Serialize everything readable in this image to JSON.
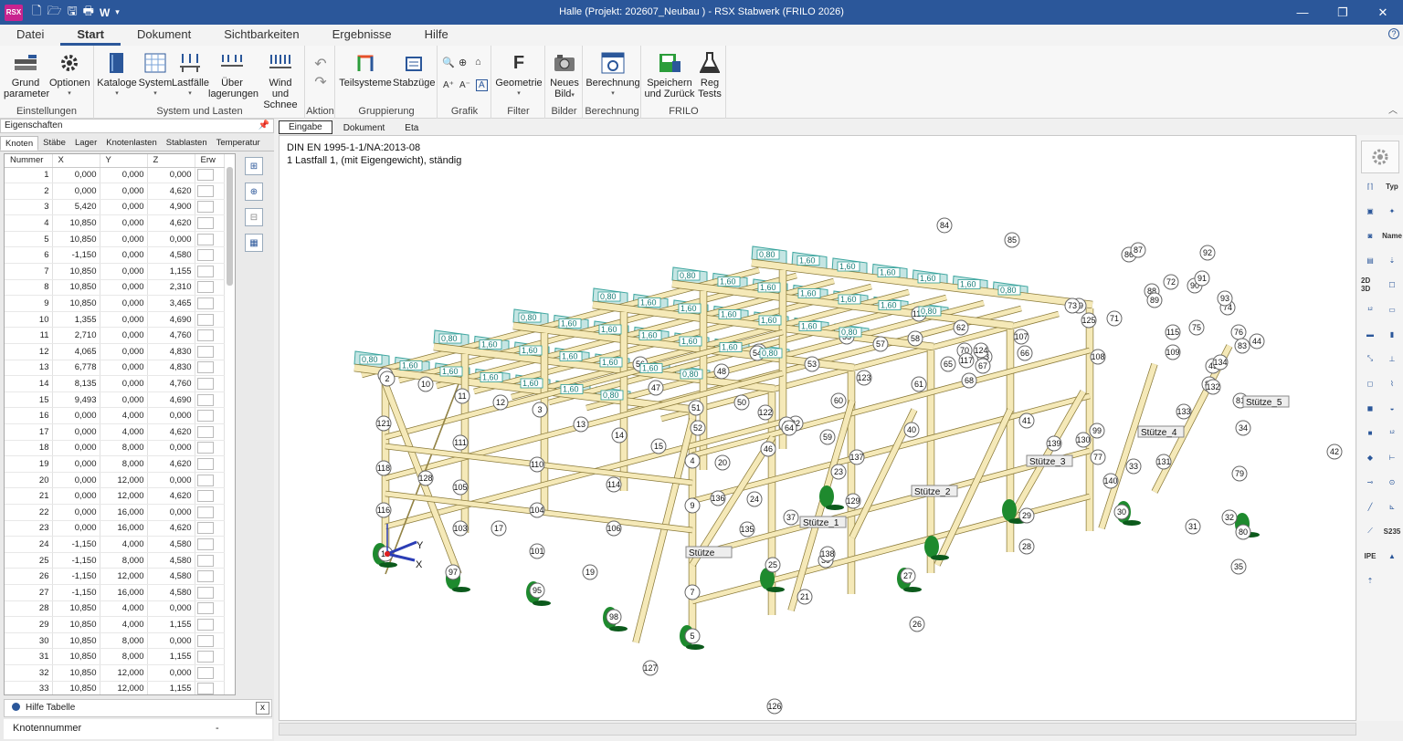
{
  "titlebar": {
    "app_icon": "RSX",
    "title": "Halle (Projekt: 202607_Neubau ) - RSX Stabwerk (FRILO 2026)",
    "quick_access": [
      "new-file-icon",
      "open-folder-icon",
      "save-icon",
      "print-icon",
      "word-icon",
      "customize-icon"
    ],
    "word_label": "W",
    "minimize": "—",
    "restore": "❐",
    "close": "✕"
  },
  "menu": {
    "tabs": [
      "Datei",
      "Start",
      "Dokument",
      "Sichtbarkeiten",
      "Ergebnisse",
      "Hilfe"
    ],
    "active": "Start"
  },
  "ribbon": {
    "groups": [
      {
        "label": "Einstellungen",
        "buttons": [
          {
            "label": "Grund\nparameter",
            "icon": "grundparameter-icon"
          },
          {
            "label": "Optionen",
            "icon": "gear-icon"
          }
        ]
      },
      {
        "label": "System und Lasten",
        "buttons": [
          {
            "label": "Kataloge",
            "icon": "book-icon"
          },
          {
            "label": "System",
            "icon": "grid-icon"
          },
          {
            "label": "Lastfälle",
            "icon": "loadcase-icon"
          },
          {
            "label": "Über\nlagerungen",
            "icon": "overlay-icon"
          },
          {
            "label": "Wind und\nSchnee",
            "icon": "wind-snow-icon"
          }
        ]
      },
      {
        "label": "Aktion",
        "buttons": [
          {
            "label": "",
            "icon": "undo-icon"
          },
          {
            "label": "",
            "icon": "redo-icon"
          }
        ]
      },
      {
        "label": "Gruppierung",
        "buttons": [
          {
            "label": "Teilsysteme",
            "icon": "subsystem-icon"
          },
          {
            "label": "Stabzüge",
            "icon": "member-chain-icon"
          }
        ]
      },
      {
        "label": "Grafik",
        "buttons": [
          {
            "label": "",
            "icon": "zoom-icon"
          }
        ]
      },
      {
        "label": "Filter",
        "buttons": [
          {
            "label": "Geometrie",
            "icon": "filter-f-icon"
          }
        ]
      },
      {
        "label": "Bilder",
        "buttons": [
          {
            "label": "Neues\nBild",
            "icon": "camera-icon"
          }
        ]
      },
      {
        "label": "Berechnung",
        "buttons": [
          {
            "label": "Berechnung",
            "icon": "calculate-icon"
          }
        ]
      },
      {
        "label": "FRILO",
        "buttons": [
          {
            "label": "Speichern\nund Zurück",
            "icon": "save-return-icon"
          },
          {
            "label": "Reg\nTests",
            "icon": "flask-icon"
          }
        ]
      }
    ],
    "grafik_glyphs": [
      "🔍",
      "⊕",
      "⌂",
      "A⁺",
      "A⁻",
      "A"
    ]
  },
  "left_panel": {
    "title": "Eigenschaften",
    "tabs": [
      "Knoten",
      "Stäbe",
      "Lager",
      "Knotenlasten",
      "Stablasten",
      "Temperatur"
    ],
    "active_tab": "Knoten",
    "columns": [
      "Nummer",
      "X",
      "Y",
      "Z",
      "Erw"
    ],
    "rows": [
      [
        "1",
        "0,000",
        "0,000",
        "0,000"
      ],
      [
        "2",
        "0,000",
        "0,000",
        "4,620"
      ],
      [
        "3",
        "5,420",
        "0,000",
        "4,900"
      ],
      [
        "4",
        "10,850",
        "0,000",
        "4,620"
      ],
      [
        "5",
        "10,850",
        "0,000",
        "0,000"
      ],
      [
        "6",
        "-1,150",
        "0,000",
        "4,580"
      ],
      [
        "7",
        "10,850",
        "0,000",
        "1,155"
      ],
      [
        "8",
        "10,850",
        "0,000",
        "2,310"
      ],
      [
        "9",
        "10,850",
        "0,000",
        "3,465"
      ],
      [
        "10",
        "1,355",
        "0,000",
        "4,690"
      ],
      [
        "11",
        "2,710",
        "0,000",
        "4,760"
      ],
      [
        "12",
        "4,065",
        "0,000",
        "4,830"
      ],
      [
        "13",
        "6,778",
        "0,000",
        "4,830"
      ],
      [
        "14",
        "8,135",
        "0,000",
        "4,760"
      ],
      [
        "15",
        "9,493",
        "0,000",
        "4,690"
      ],
      [
        "16",
        "0,000",
        "4,000",
        "0,000"
      ],
      [
        "17",
        "0,000",
        "4,000",
        "4,620"
      ],
      [
        "18",
        "0,000",
        "8,000",
        "0,000"
      ],
      [
        "19",
        "0,000",
        "8,000",
        "4,620"
      ],
      [
        "20",
        "0,000",
        "12,000",
        "0,000"
      ],
      [
        "21",
        "0,000",
        "12,000",
        "4,620"
      ],
      [
        "22",
        "0,000",
        "16,000",
        "0,000"
      ],
      [
        "23",
        "0,000",
        "16,000",
        "4,620"
      ],
      [
        "24",
        "-1,150",
        "4,000",
        "4,580"
      ],
      [
        "25",
        "-1,150",
        "8,000",
        "4,580"
      ],
      [
        "26",
        "-1,150",
        "12,000",
        "4,580"
      ],
      [
        "27",
        "-1,150",
        "16,000",
        "4,580"
      ],
      [
        "28",
        "10,850",
        "4,000",
        "0,000"
      ],
      [
        "29",
        "10,850",
        "4,000",
        "1,155"
      ],
      [
        "30",
        "10,850",
        "8,000",
        "0,000"
      ],
      [
        "31",
        "10,850",
        "8,000",
        "1,155"
      ],
      [
        "32",
        "10,850",
        "12,000",
        "0,000"
      ],
      [
        "33",
        "10,850",
        "12,000",
        "1,155"
      ]
    ],
    "help_title": "Hilfe Tabelle",
    "help_close": "x",
    "help_field": "Knotennummer",
    "help_value": "-"
  },
  "view": {
    "tabs": [
      "Eingabe",
      "Dokument",
      "Eta"
    ],
    "active_tab": "Eingabe",
    "norm": "DIN EN 1995-1-1/NA:2013-08",
    "loadcase": "1 Lastfall 1, (mit Eigengewicht), ständig",
    "axes": {
      "y": "Y",
      "x": "X"
    },
    "nodes": [
      {
        "n": "1"
      },
      {
        "n": "2"
      },
      {
        "n": "3"
      },
      {
        "n": "4"
      },
      {
        "n": "5"
      },
      {
        "n": "7"
      },
      {
        "n": "9"
      },
      {
        "n": "10"
      },
      {
        "n": "11"
      },
      {
        "n": "12"
      },
      {
        "n": "13"
      },
      {
        "n": "14"
      },
      {
        "n": "15"
      },
      {
        "n": "16"
      },
      {
        "n": "17"
      },
      {
        "n": "19"
      },
      {
        "n": "20"
      },
      {
        "n": "21"
      },
      {
        "n": "22"
      },
      {
        "n": "23"
      },
      {
        "n": "24"
      },
      {
        "n": "25"
      },
      {
        "n": "26"
      },
      {
        "n": "27"
      },
      {
        "n": "28"
      },
      {
        "n": "29"
      },
      {
        "n": "30"
      },
      {
        "n": "31"
      },
      {
        "n": "32"
      },
      {
        "n": "33"
      },
      {
        "n": "34"
      },
      {
        "n": "35"
      },
      {
        "n": "37"
      },
      {
        "n": "39"
      },
      {
        "n": "40"
      },
      {
        "n": "41"
      },
      {
        "n": "42"
      },
      {
        "n": "43"
      },
      {
        "n": "44"
      },
      {
        "n": "45"
      },
      {
        "n": "46"
      },
      {
        "n": "47"
      },
      {
        "n": "48"
      },
      {
        "n": "49"
      },
      {
        "n": "50"
      },
      {
        "n": "51"
      },
      {
        "n": "52"
      },
      {
        "n": "53"
      },
      {
        "n": "54"
      },
      {
        "n": "55"
      },
      {
        "n": "56"
      },
      {
        "n": "57"
      },
      {
        "n": "58"
      },
      {
        "n": "59"
      },
      {
        "n": "60"
      },
      {
        "n": "61"
      },
      {
        "n": "62"
      },
      {
        "n": "63"
      },
      {
        "n": "64"
      },
      {
        "n": "65"
      },
      {
        "n": "66"
      },
      {
        "n": "67"
      },
      {
        "n": "68"
      },
      {
        "n": "69"
      },
      {
        "n": "70"
      },
      {
        "n": "71"
      },
      {
        "n": "72"
      },
      {
        "n": "73"
      },
      {
        "n": "74"
      },
      {
        "n": "75"
      },
      {
        "n": "76"
      },
      {
        "n": "77"
      },
      {
        "n": "79"
      },
      {
        "n": "80"
      },
      {
        "n": "81"
      },
      {
        "n": "82"
      },
      {
        "n": "83"
      },
      {
        "n": "84"
      },
      {
        "n": "85"
      },
      {
        "n": "86"
      },
      {
        "n": "87"
      },
      {
        "n": "88"
      },
      {
        "n": "89"
      },
      {
        "n": "90"
      },
      {
        "n": "91"
      },
      {
        "n": "92"
      },
      {
        "n": "93"
      },
      {
        "n": "95"
      },
      {
        "n": "97"
      },
      {
        "n": "98"
      },
      {
        "n": "99"
      },
      {
        "n": "101"
      },
      {
        "n": "103"
      },
      {
        "n": "104"
      },
      {
        "n": "105"
      },
      {
        "n": "106"
      },
      {
        "n": "107"
      },
      {
        "n": "108"
      },
      {
        "n": "109"
      },
      {
        "n": "110"
      },
      {
        "n": "111"
      },
      {
        "n": "114"
      },
      {
        "n": "115"
      },
      {
        "n": "116"
      },
      {
        "n": "117"
      },
      {
        "n": "118"
      },
      {
        "n": "119"
      },
      {
        "n": "121"
      },
      {
        "n": "122"
      },
      {
        "n": "123"
      },
      {
        "n": "124"
      },
      {
        "n": "125"
      },
      {
        "n": "126"
      },
      {
        "n": "127"
      },
      {
        "n": "128"
      },
      {
        "n": "129"
      },
      {
        "n": "130"
      },
      {
        "n": "131"
      },
      {
        "n": "132"
      },
      {
        "n": "133"
      },
      {
        "n": "134"
      },
      {
        "n": "135"
      },
      {
        "n": "136"
      },
      {
        "n": "137"
      },
      {
        "n": "138"
      },
      {
        "n": "139"
      },
      {
        "n": "140"
      }
    ],
    "stuetze_labels": [
      "Stütze",
      "Stütze_1",
      "Stütze_2",
      "Stütze_3",
      "Stütze_4",
      "Stütze_5"
    ],
    "load_values": [
      "0,80",
      "1,60"
    ]
  },
  "right_tools": [
    "settings-icon",
    "frame-icon",
    "typ-icon",
    "view3d-icon",
    "pin-icon",
    "camera-icon",
    "name-icon",
    "doc-icon",
    "load-icon",
    "2d3d-icon",
    "square-icon",
    "numbering-icon",
    "panel-icon",
    "hatch-icon",
    "chart-icon",
    "axes-icon",
    "support-icon",
    "box-icon",
    "spring-icon",
    "cube-icon",
    "diagram-icon",
    "cube-dark-icon",
    "value-icon",
    "slab-icon",
    "dim-icon",
    "length-icon",
    "node-icon",
    "line-icon",
    "coordinate-icon",
    "member-icon",
    "material-icon",
    "section-icon",
    "triangle-icon",
    "arrow-up-icon"
  ],
  "right_tool_labels": {
    "typ": "Typ",
    "name": "Name",
    "s235": "S235",
    "ipe": "IPE",
    "2d3d": "2D 3D"
  },
  "colors": {
    "titlebar": "#2b579a",
    "accent": "#2b579a",
    "timber": "#f5e9b8",
    "timber_edge": "#8a7a3a",
    "load_panel": "#bfe3e0",
    "load_edge": "#2a9d96",
    "support": "#1e8a2e"
  }
}
